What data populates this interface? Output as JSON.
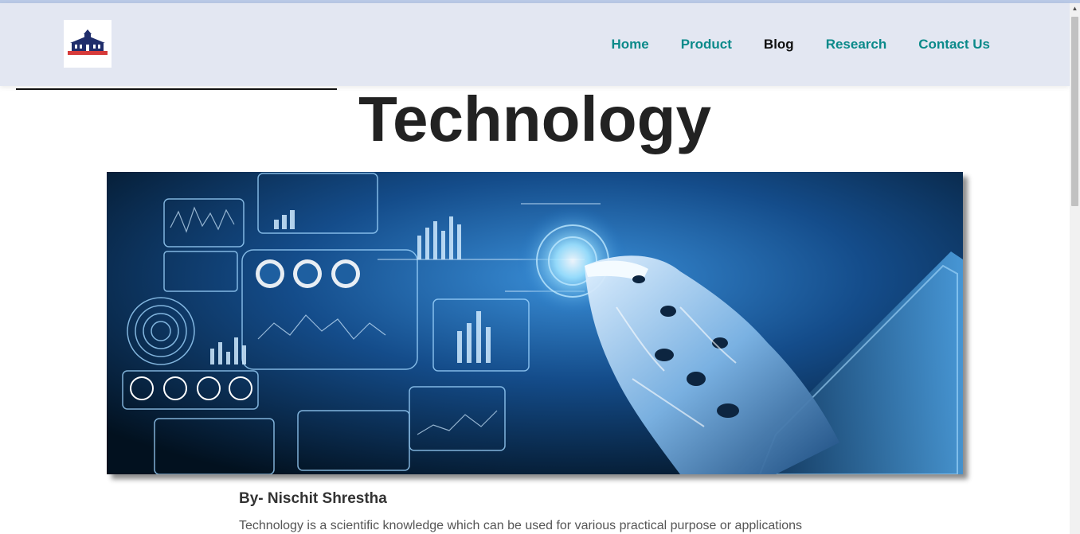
{
  "nav": {
    "logo_icon": "school-building-logo",
    "items": [
      {
        "label": "Home",
        "active": false
      },
      {
        "label": "Product",
        "active": false
      },
      {
        "label": "Blog",
        "active": true
      },
      {
        "label": "Research",
        "active": false
      },
      {
        "label": "Contact Us",
        "active": false
      }
    ],
    "link_color": "#0b8a8a",
    "active_color": "#111111"
  },
  "article": {
    "title": "Technology",
    "hero_image": "robot-hand-touching-digital-dashboard",
    "author": "By- Nischit Shrestha",
    "intro": "Technology is a scientific knowledge which can be used for various practical purpose or applications"
  },
  "colors": {
    "navbar_bg": "#e3e7f2",
    "title": "#222222"
  }
}
